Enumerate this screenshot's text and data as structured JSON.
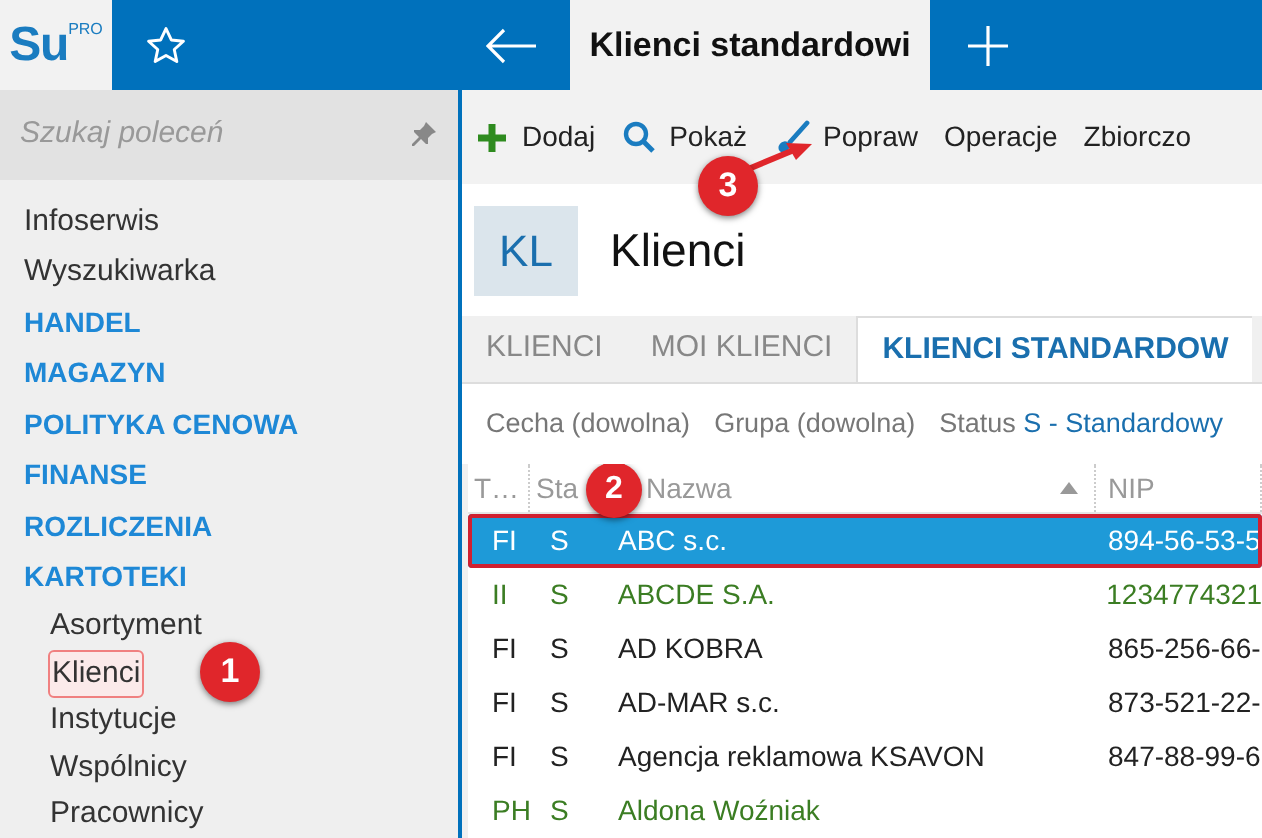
{
  "app": {
    "logo": "Su",
    "logo_badge": "PRO"
  },
  "document_tab": {
    "title": "Klienci standardowi"
  },
  "sidebar": {
    "search": {
      "placeholder": "Szukaj poleceń"
    },
    "items": [
      {
        "label": "Infoserwis",
        "kind": "link",
        "selected": false
      },
      {
        "label": "Wyszukiwarka",
        "kind": "link",
        "selected": false
      },
      {
        "label": "HANDEL",
        "kind": "section",
        "selected": false
      },
      {
        "label": "MAGAZYN",
        "kind": "section",
        "selected": false
      },
      {
        "label": "POLITYKA CENOWA",
        "kind": "section",
        "selected": false
      },
      {
        "label": "FINANSE",
        "kind": "section",
        "selected": false
      },
      {
        "label": "ROZLICZENIA",
        "kind": "section",
        "selected": false
      },
      {
        "label": "KARTOTEKI",
        "kind": "section",
        "selected": false,
        "children": [
          {
            "label": "Asortyment",
            "selected": false
          },
          {
            "label": "Klienci",
            "selected": true,
            "callout": "1"
          },
          {
            "label": "Instytucje",
            "selected": false
          },
          {
            "label": "Wspólnicy",
            "selected": false
          },
          {
            "label": "Pracownicy",
            "selected": false
          }
        ]
      }
    ]
  },
  "toolbar": [
    {
      "label": "Dodaj",
      "kind": "add"
    },
    {
      "label": "Pokaż",
      "kind": "search"
    },
    {
      "label": "Popraw",
      "kind": "edit",
      "callout": "3"
    },
    {
      "label": "Operacje",
      "kind": "text"
    },
    {
      "label": "Zbiorczo",
      "kind": "text"
    }
  ],
  "module": {
    "badge": "KL",
    "title": "Klienci"
  },
  "tabs": [
    {
      "label": "KLIENCI",
      "selected": false
    },
    {
      "label": "MOI KLIENCI",
      "selected": false
    },
    {
      "label": "KLIENCI STANDARDOW",
      "selected": true
    }
  ],
  "filters": [
    {
      "label": "Cecha (dowolna)"
    },
    {
      "label": "Grupa (dowolna)"
    },
    {
      "label": "Status",
      "value": "S - Standardowy"
    }
  ],
  "table": {
    "columns": [
      {
        "label": "T…"
      },
      {
        "label": "Sta",
        "callout": "2"
      },
      {
        "label": "Nazwa",
        "sorted": true
      },
      {
        "label": "NIP"
      }
    ],
    "rows": [
      {
        "cells": [
          "FI",
          "S",
          "ABC s.c.",
          "894-56-53-5"
        ],
        "selected": true
      },
      {
        "cells": [
          "II",
          "S",
          "ABCDE S.A.",
          "1234774321"
        ],
        "selected": false,
        "color": "#3b7d23"
      },
      {
        "cells": [
          "FI",
          "S",
          "AD KOBRA",
          "865-256-66-"
        ],
        "selected": false
      },
      {
        "cells": [
          "FI",
          "S",
          "AD-MAR s.c.",
          "873-521-22-"
        ],
        "selected": false
      },
      {
        "cells": [
          "FI",
          "S",
          "Agencja reklamowa KSAVON",
          "847-88-99-6"
        ],
        "selected": false
      },
      {
        "cells": [
          "PH",
          "S",
          "Aldona Woźniak",
          ""
        ],
        "selected": false,
        "color": "#3b7d23"
      }
    ]
  }
}
